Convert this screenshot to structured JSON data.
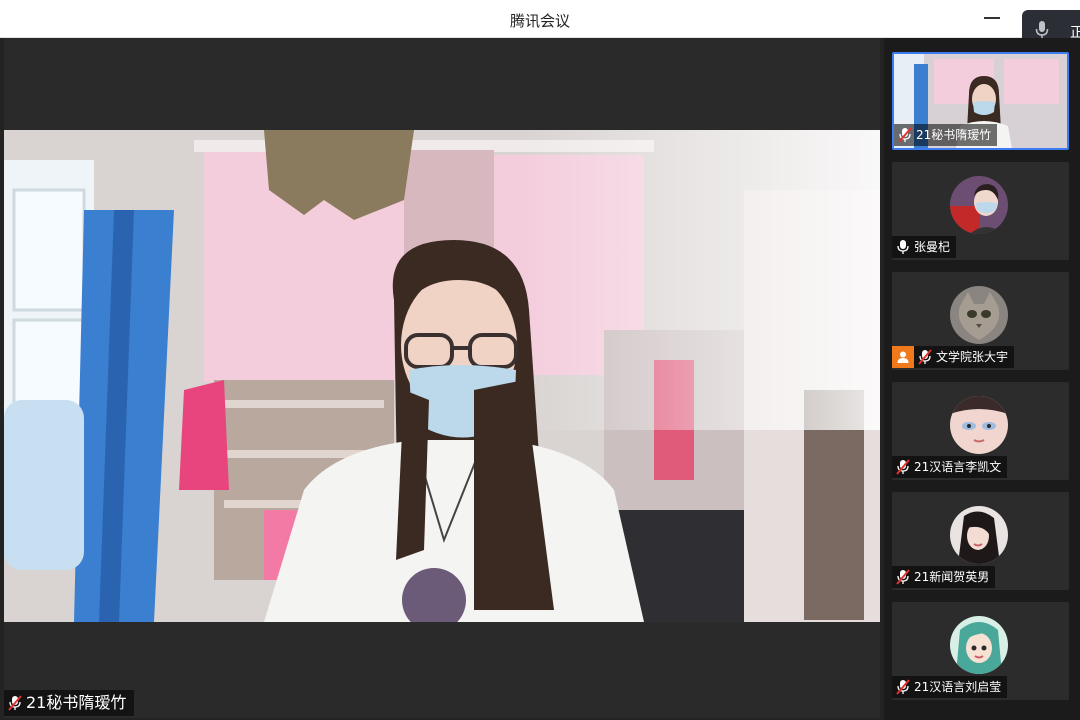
{
  "window": {
    "title": "腾讯会议"
  },
  "mic_pill": {
    "text": "正"
  },
  "main": {
    "speaker_name": "21秘书隋瑷竹"
  },
  "participants": [
    {
      "name": "21秘书隋瑷竹",
      "mic": "muted",
      "active": true
    },
    {
      "name": "张曼杞",
      "mic": "on",
      "active": false
    },
    {
      "name": "文学院张大宇",
      "mic": "muted",
      "active": false,
      "badge": "person-icon"
    },
    {
      "name": "21汉语言李凯文",
      "mic": "muted",
      "active": false
    },
    {
      "name": "21新闻贺英男",
      "mic": "muted",
      "active": false
    },
    {
      "name": "21汉语言刘启莹",
      "mic": "muted",
      "active": false
    }
  ],
  "colors": {
    "active_border": "#3d7cf0",
    "mute_red": "#e5322d",
    "badge_orange": "#f07a1b"
  }
}
